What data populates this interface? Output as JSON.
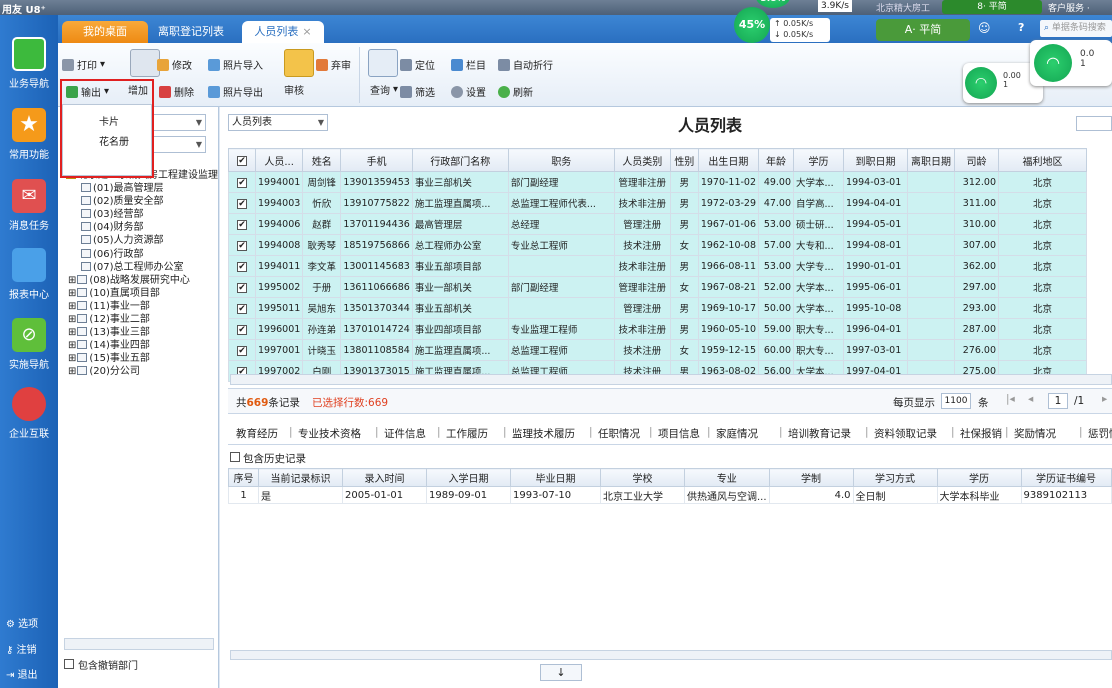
{
  "app": {
    "brand": "用友 U8⁺",
    "org": "北京精大房工",
    "service": "客户服务 ·"
  },
  "net": {
    "speed_top": "3.9K/s",
    "up": "0.05K/s",
    "down": "0.05K/s",
    "percent": "45%",
    "badge_top": "3.8%",
    "w1a": "0.00",
    "w1b": "1",
    "w2a": "0.0",
    "w2b": "1",
    "deco1": "A· 平简",
    "deco2": "8· 平简"
  },
  "nav": {
    "items": [
      "业务导航",
      "常用功能",
      "消息任务",
      "报表中心",
      "实施导航",
      "企业互联"
    ],
    "bottom": [
      "选项",
      "注销",
      "退出"
    ]
  },
  "tabs": {
    "home": "我的桌面",
    "history": "离职登记列表",
    "active": "人员列表",
    "close": "×"
  },
  "toolbar": {
    "print": "打印",
    "edit": "修改",
    "photo_import": "照片导入",
    "abandon": "弃审",
    "locate": "定位",
    "columns": "栏目",
    "autowrap": "自动折行",
    "export": "输出",
    "add": "增加",
    "delete": "删除",
    "photo_export": "照片导出",
    "audit": "审核",
    "query": "查询",
    "filter": "筛选",
    "settings": "设置",
    "refresh": "刷新"
  },
  "export_menu": [
    "卡片",
    "花名册"
  ],
  "search": {
    "placeholder": "单据条码搜索"
  },
  "left": {
    "tree_root": "北京建工京精大房工程建设监理",
    "tree": [
      "(01)最高管理层",
      "(02)质量安全部",
      "(03)经营部",
      "(04)财务部",
      "(05)人力资源部",
      "(06)行政部",
      "(07)总工程师办公室",
      "(08)战略发展研究中心",
      "(10)直属项目部",
      "(11)事业一部",
      "(12)事业二部",
      "(13)事业三部",
      "(14)事业四部",
      "(15)事业五部",
      "(20)分公司"
    ],
    "include_cancelled": "包含撤销部门"
  },
  "main": {
    "view_select": "人员列表",
    "title": "人员列表"
  },
  "grid": {
    "columns": [
      "✔",
      "人员...",
      "姓名",
      "手机",
      "行政部门名称",
      "职务",
      "人员类别",
      "性别",
      "出生日期",
      "年龄",
      "学历",
      "到职日期",
      "离职日期",
      "司龄",
      "福利地区"
    ],
    "rows": [
      [
        "✔",
        "1994001",
        "周剑锋",
        "13901359453",
        "事业三部机关",
        "部门副经理",
        "管理非注册",
        "男",
        "1970-11-02",
        "49.00",
        "大学本...",
        "1994-03-01",
        "",
        "312.00",
        "北京"
      ],
      [
        "✔",
        "1994003",
        "忻欣",
        "13910775822",
        "施工监理直属项...",
        "总监理工程师代表...",
        "技术非注册",
        "男",
        "1972-03-29",
        "47.00",
        "自学高...",
        "1994-04-01",
        "",
        "311.00",
        "北京"
      ],
      [
        "✔",
        "1994006",
        "赵群",
        "13701194436",
        "最高管理层",
        "总经理",
        "管理注册",
        "男",
        "1967-01-06",
        "53.00",
        "硕士研...",
        "1994-05-01",
        "",
        "310.00",
        "北京"
      ],
      [
        "✔",
        "1994008",
        "耿秀琴",
        "18519756866",
        "总工程师办公室",
        "专业总工程师",
        "技术注册",
        "女",
        "1962-10-08",
        "57.00",
        "大专和...",
        "1994-08-01",
        "",
        "307.00",
        "北京"
      ],
      [
        "✔",
        "1994011",
        "李文革",
        "13001145683",
        "事业五部项目部",
        "",
        "技术非注册",
        "男",
        "1966-08-11",
        "53.00",
        "大学专...",
        "1990-01-01",
        "",
        "362.00",
        "北京"
      ],
      [
        "✔",
        "1995002",
        "于册",
        "13611066686",
        "事业一部机关",
        "部门副经理",
        "管理非注册",
        "女",
        "1967-08-21",
        "52.00",
        "大学本...",
        "1995-06-01",
        "",
        "297.00",
        "北京"
      ],
      [
        "✔",
        "1995011",
        "吴旭东",
        "13501370344",
        "事业五部机关",
        "",
        "管理注册",
        "男",
        "1969-10-17",
        "50.00",
        "大学本...",
        "1995-10-08",
        "",
        "293.00",
        "北京"
      ],
      [
        "✔",
        "1996001",
        "孙连弟",
        "13701014724",
        "事业四部项目部",
        "专业监理工程师",
        "技术非注册",
        "男",
        "1960-05-10",
        "59.00",
        "职大专...",
        "1996-04-01",
        "",
        "287.00",
        "北京"
      ],
      [
        "✔",
        "1997001",
        "计晓玉",
        "13801108584",
        "施工监理直属项...",
        "总监理工程师",
        "技术注册",
        "女",
        "1959-12-15",
        "60.00",
        "职大专...",
        "1997-03-01",
        "",
        "276.00",
        "北京"
      ],
      [
        "✔",
        "1997002",
        "白刚",
        "13901373015",
        "施工监理直属项...",
        "总监理工程师",
        "技术注册",
        "男",
        "1963-08-02",
        "56.00",
        "大学本...",
        "1997-04-01",
        "",
        "275.00",
        "北京"
      ]
    ]
  },
  "status": {
    "total_prefix": "共",
    "total_count": "669",
    "total_suffix": "条记录",
    "selected": "已选择行数:669",
    "per_page": "每页显示",
    "per_page_value": "1100",
    "per_page_unit": "条",
    "page": "1",
    "pages": "/1"
  },
  "subtabs": [
    "教育经历",
    "专业技术资格",
    "证件信息",
    "工作履历",
    "监理技术履历",
    "任职情况",
    "项目信息",
    "家庭情况",
    "培训教育记录",
    "资料领取记录",
    "社保报销",
    "奖励情况",
    "惩罚情"
  ],
  "include_history": "包含历史记录",
  "grid2": {
    "columns": [
      "序号",
      "当前记录标识",
      "录入时间",
      "入学日期",
      "毕业日期",
      "学校",
      "专业",
      "学制",
      "学习方式",
      "学历",
      "学历证书编号"
    ],
    "rows": [
      [
        "1",
        "是",
        "2005-01-01",
        "1989-09-01",
        "1993-07-10",
        "北京工业大学",
        "供热通风与空调...",
        "4.0",
        "全日制",
        "大学本科毕业",
        "9389102113"
      ]
    ]
  },
  "colors": {
    "nav": "#1c62b6",
    "highlight": "#ccf2f2",
    "red": "#e02020"
  }
}
